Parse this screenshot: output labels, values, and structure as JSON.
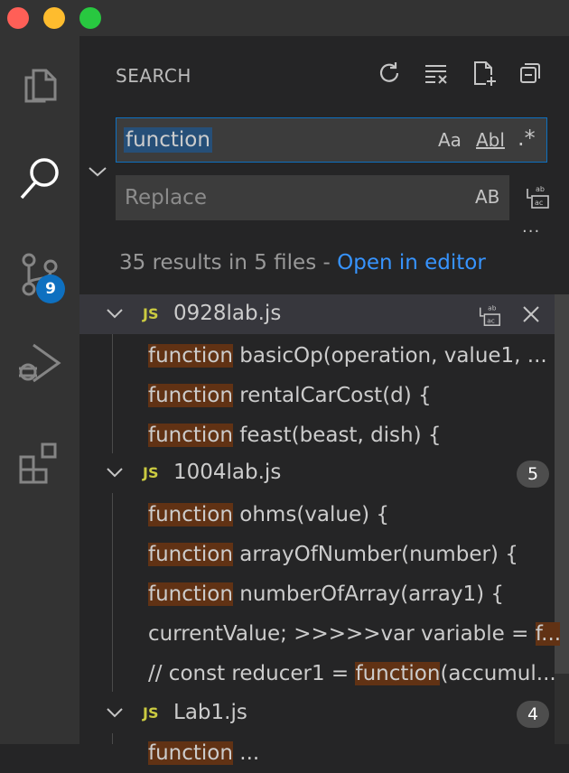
{
  "window": {
    "traffic_lights": {
      "close_color": "#ff5f57",
      "minimize_color": "#febc2e",
      "maximize_color": "#28c840"
    }
  },
  "activity_bar": {
    "items": [
      {
        "name": "explorer",
        "icon": "files-icon"
      },
      {
        "name": "search",
        "icon": "search-icon"
      },
      {
        "name": "source-control",
        "icon": "source-control-icon",
        "badge": "9"
      },
      {
        "name": "run-debug",
        "icon": "run-debug-icon"
      },
      {
        "name": "extensions",
        "icon": "extensions-icon"
      }
    ]
  },
  "search": {
    "title": "SEARCH",
    "query": "function",
    "options": {
      "match_case": "Aa",
      "whole_word": "Abl",
      "regex": ".*"
    },
    "replace_placeholder": "Replace",
    "preserve_case": "AB",
    "more_actions": "···",
    "summary": "35 results in 5 files - ",
    "open_in_editor": "Open in editor"
  },
  "results": {
    "files": [
      {
        "name": "0928lab.js",
        "icon": "JS",
        "matches": [
          {
            "match": "function",
            "rest": " basicOp(operation, value1, ..."
          },
          {
            "match": "function",
            "rest": " rentalCarCost(d) {"
          },
          {
            "match": "function",
            "rest": " feast(beast, dish) {"
          }
        ]
      },
      {
        "name": "1004lab.js",
        "icon": "JS",
        "count": "5",
        "matches": [
          {
            "match": "function",
            "rest": " ohms(value) {"
          },
          {
            "match": "function",
            "rest": " arrayOfNumber(number) {"
          },
          {
            "match": "function",
            "rest": " numberOfArray(array1) {"
          },
          {
            "before": "currentValue;  >>>>>var variable = ",
            "match": "f..."
          },
          {
            "before": "// const reducer1 = ",
            "match": "function",
            "rest": "(accumul..."
          }
        ]
      },
      {
        "name": "Lab1.js",
        "icon": "JS",
        "count": "4",
        "matches": [
          {
            "match": "function",
            "rest": " ..."
          }
        ]
      }
    ]
  },
  "colors": {
    "accent": "#0e70c0",
    "link": "#3794ff",
    "match_highlight": "#613214",
    "selection": "#264f78",
    "js_icon": "#cbcb41"
  }
}
